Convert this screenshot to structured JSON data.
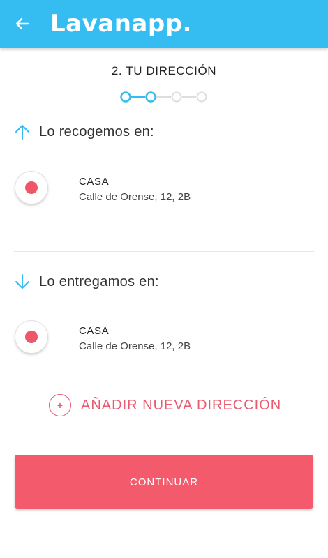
{
  "header": {
    "back_icon": "arrow-left-icon",
    "logo_text": "Lavanapp."
  },
  "step": {
    "title": "2. TU DIRECCIÓN",
    "total_steps": 4,
    "current_step": 2
  },
  "pickup": {
    "label": "Lo recogemos en:",
    "icon": "arrow-up-icon",
    "address": {
      "name": "CASA",
      "line": "Calle de Orense, 12, 2B",
      "selected": true
    }
  },
  "delivery": {
    "label": "Lo entregamos en:",
    "icon": "arrow-down-icon",
    "address": {
      "name": "CASA",
      "line": "Calle de Orense, 12, 2B",
      "selected": true
    }
  },
  "add_address": {
    "icon": "plus-icon",
    "label": "AÑADIR NUEVA DIRECCIÓN"
  },
  "continue_button": {
    "label": "CONTINUAR"
  },
  "colors": {
    "header": "#35bdf2",
    "accent_blue": "#35bdf2",
    "accent_red": "#f35a6c",
    "radio_dot": "#f0566a"
  }
}
